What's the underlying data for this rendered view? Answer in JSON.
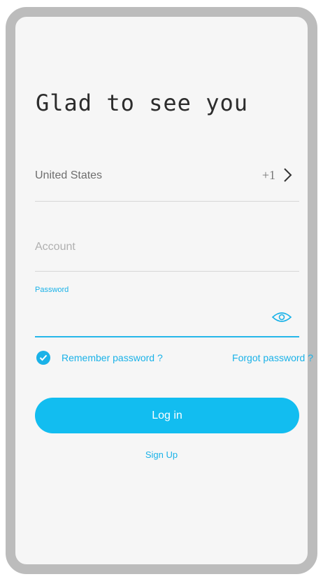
{
  "screen": {
    "title": "Glad to see you"
  },
  "country": {
    "label": "United States",
    "code": "+1",
    "chevron_icon": "chevron-right-icon"
  },
  "account": {
    "placeholder": "Account",
    "value": ""
  },
  "password": {
    "label": "Password",
    "value": "",
    "toggle_icon": "eye-icon"
  },
  "remember": {
    "checked": true,
    "label": "Remember password ?"
  },
  "forgot": {
    "label": "Forgot password ?"
  },
  "login": {
    "label": "Log in"
  },
  "signup": {
    "label": "Sign Up"
  },
  "colors": {
    "accent": "#12bdf0",
    "frame": "#bcbcbc",
    "background": "#f6f6f6"
  }
}
